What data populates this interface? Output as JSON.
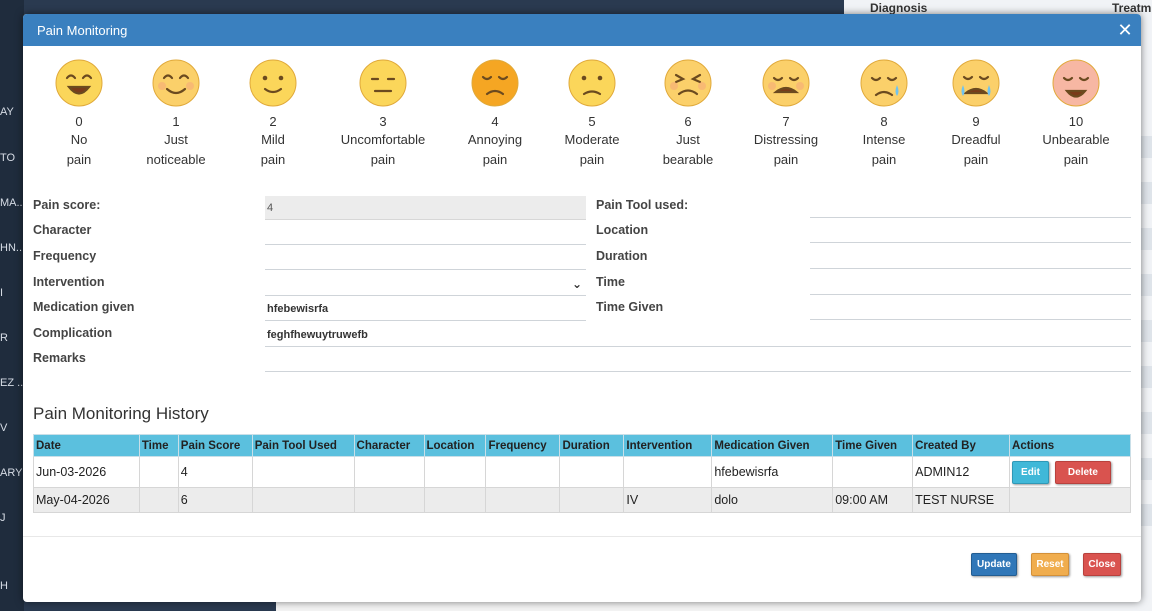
{
  "background": {
    "left_items": [
      "AY",
      "TO",
      "MA...",
      "HN...",
      "I",
      "R",
      "EZ ...",
      "V",
      "ARY",
      "J",
      "H"
    ],
    "right_header": "Diagnosis",
    "right_header2": "Treatm"
  },
  "modal": {
    "title": "Pain Monitoring",
    "close_icon": "close-icon"
  },
  "pain_scale": [
    {
      "score": "0",
      "line1": "No",
      "line2": "pain",
      "color": "#fbd65a"
    },
    {
      "score": "1",
      "line1": "Just",
      "line2": "noticeable",
      "color": "#fbd06a"
    },
    {
      "score": "2",
      "line1": "Mild",
      "line2": "pain",
      "color": "#fbd65a"
    },
    {
      "score": "3",
      "line1": "Uncomfortable",
      "line2": "pain",
      "color": "#fbd65a"
    },
    {
      "score": "4",
      "line1": "Annoying",
      "line2": "pain",
      "color": "#f5a623"
    },
    {
      "score": "5",
      "line1": "Moderate",
      "line2": "pain",
      "color": "#fbd65a"
    },
    {
      "score": "6",
      "line1": "Just",
      "line2": "bearable",
      "color": "#fbd06a"
    },
    {
      "score": "7",
      "line1": "Distressing",
      "line2": "pain",
      "color": "#fbd06a"
    },
    {
      "score": "8",
      "line1": "Intense",
      "line2": "pain",
      "color": "#fbd06a"
    },
    {
      "score": "9",
      "line1": "Dreadful",
      "line2": "pain",
      "color": "#fbd06a"
    },
    {
      "score": "10",
      "line1": "Unbearable",
      "line2": "pain",
      "color": "#f7b7a3"
    }
  ],
  "form": {
    "pain_score_label": "Pain score:",
    "pain_score_value": "4",
    "character_label": "Character",
    "character_value": "",
    "frequency_label": "Frequency",
    "frequency_value": "",
    "intervention_label": "Intervention",
    "intervention_value": "",
    "medication_label": "Medication given",
    "medication_value": "hfebewisrfa",
    "complication_label": "Complication",
    "complication_value": "feghfhewuytruwefb",
    "remarks_label": "Remarks",
    "remarks_value": "",
    "pain_tool_label": "Pain Tool used:",
    "pain_tool_value": "",
    "location_label": "Location",
    "location_value": "",
    "duration_label": "Duration",
    "duration_value": "",
    "time_label": "Time",
    "time_value": "",
    "time_given_label": "Time Given",
    "time_given_value": ""
  },
  "history": {
    "title": "Pain Monitoring History",
    "columns": [
      "Date",
      "Time",
      "Pain Score",
      "Pain Tool Used",
      "Character",
      "Location",
      "Frequency",
      "Duration",
      "Intervention",
      "Medication Given",
      "Time Given",
      "Created By",
      "Actions"
    ],
    "rows": [
      [
        "Jun-03-2026",
        "",
        "4",
        "",
        "",
        "",
        "",
        "",
        "",
        "hfebewisrfa",
        "",
        "ADMIN12"
      ],
      [
        "May-04-2026",
        "",
        "6",
        "",
        "",
        "",
        "",
        "",
        "IV",
        "dolo",
        "09:00 AM",
        "TEST NURSE"
      ]
    ],
    "edit_label": "Edit",
    "delete_label": "Delete"
  },
  "footer": {
    "update_label": "Update",
    "reset_label": "Reset",
    "close_label": "Close"
  }
}
